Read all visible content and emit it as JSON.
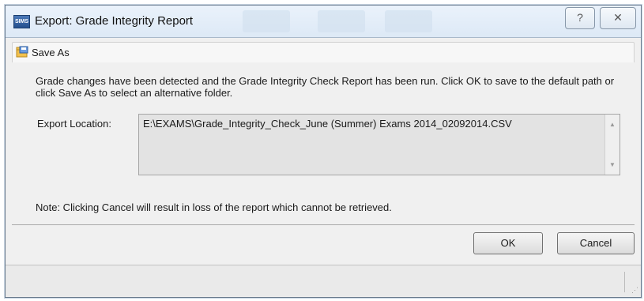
{
  "window": {
    "title": "Export: Grade Integrity Report",
    "app_icon_text": "SIMS",
    "help_glyph": "?",
    "close_glyph": "✕"
  },
  "header": {
    "icon": "save-as-icon",
    "label": "Save As"
  },
  "content": {
    "message": "Grade changes have been detected and the Grade Integrity Check Report has been run. Click OK to save to the default path or click Save As to select an alternative folder.",
    "export_location_label": "Export Location:",
    "export_location_value": "E:\\EXAMS\\Grade_Integrity_Check_June (Summer) Exams 2014_02092014.CSV",
    "note": "Note: Clicking Cancel will result in loss of the report which cannot be retrieved."
  },
  "buttons": {
    "ok": "OK",
    "cancel": "Cancel"
  },
  "colors": {
    "titlebar": "#dde9f6",
    "window_bg": "#f0f0f0",
    "field_bg": "#e3e3e3"
  }
}
